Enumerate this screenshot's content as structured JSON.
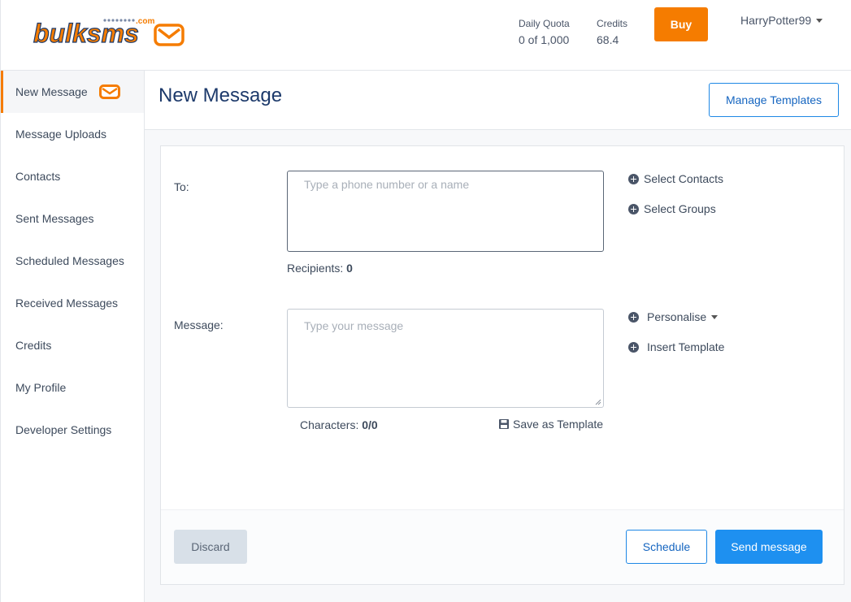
{
  "brand": {
    "logo_text": "bulksms",
    "logo_suffix": ".com",
    "accent": "#f57c00",
    "primary_blue": "#1e88e5"
  },
  "header": {
    "quota_label": "Daily Quota",
    "quota_value": "0 of 1,000",
    "credits_label": "Credits",
    "credits_value": "68.4",
    "buy_label": "Buy",
    "username": "HarryPotter99"
  },
  "sidebar": {
    "items": [
      {
        "label": "New Message",
        "active": true
      },
      {
        "label": "Message Uploads"
      },
      {
        "label": "Contacts"
      },
      {
        "label": "Sent Messages"
      },
      {
        "label": "Scheduled Messages"
      },
      {
        "label": "Received Messages"
      },
      {
        "label": "Credits"
      },
      {
        "label": "My Profile"
      },
      {
        "label": "Developer Settings"
      }
    ]
  },
  "main": {
    "title": "New Message",
    "manage_templates_label": "Manage Templates"
  },
  "form": {
    "to_label": "To:",
    "to_placeholder": "Type a phone number or a name",
    "recipients_label": "Recipients:",
    "recipients_count": "0",
    "select_contacts": "Select Contacts",
    "select_groups": "Select Groups",
    "message_label": "Message:",
    "message_placeholder": "Type your message",
    "characters_label": "Characters:",
    "characters_count": "0/0",
    "save_template": "Save as Template",
    "personalise": "Personalise",
    "insert_template": "Insert Template"
  },
  "footer": {
    "discard_label": "Discard",
    "schedule_label": "Schedule",
    "send_label": "Send message"
  }
}
